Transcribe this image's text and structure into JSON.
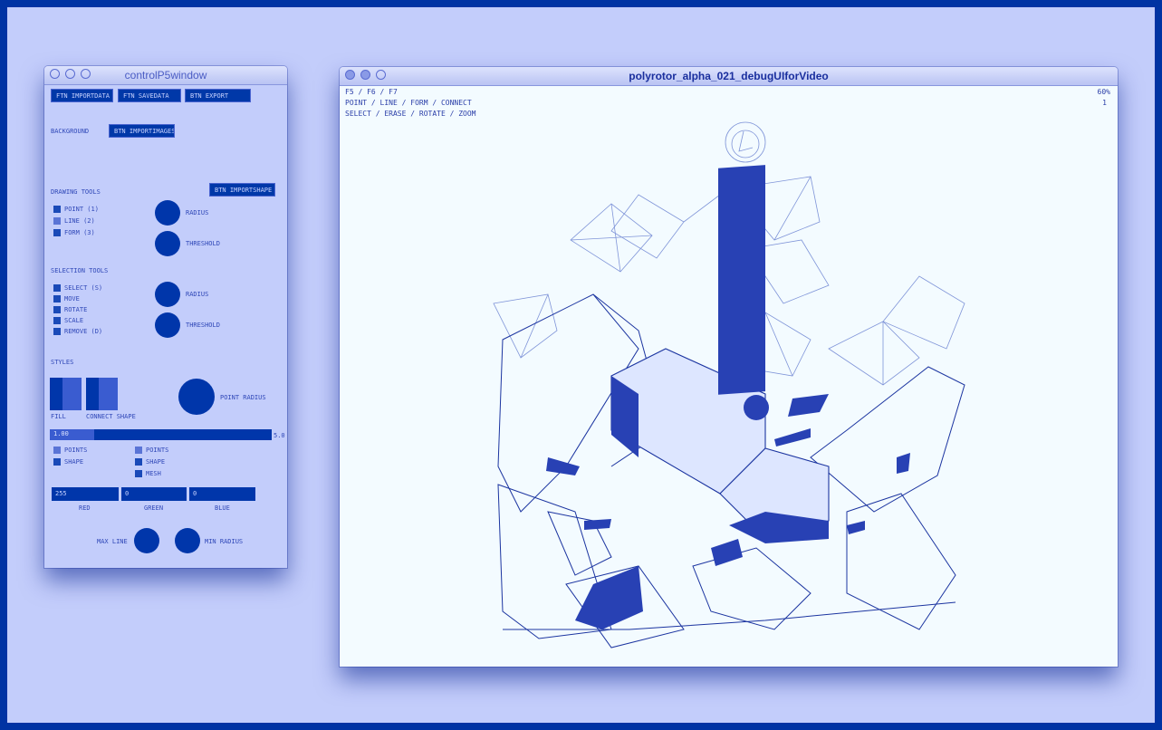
{
  "control_window": {
    "title": "controlP5window",
    "buttons": {
      "import": "FTN IMPORTDATA",
      "savedata": "FTN SAVEDATA",
      "export": "BTN EXPORT",
      "background": "BTN IMPORTIMAGES",
      "import_shape": "BTN IMPORTSHAPE"
    },
    "labels": {
      "background": "BACKGROUND",
      "drawing_tools": "DRAWING TOOLS",
      "selection_tools": "SELECTION TOOLS",
      "styles": "STYLES",
      "fill": "FILL",
      "connect_shape": "CONNECT SHAPE",
      "red": "RED",
      "green": "GREEN",
      "blue": "BLUE"
    },
    "drawing_items": [
      "POINT (1)",
      "LINE (2)",
      "FORM (3)"
    ],
    "selection_items": [
      "SELECT (S)",
      "MOVE",
      "ROTATE",
      "SCALE",
      "REMOVE (D)"
    ],
    "knob_labels": {
      "radius1": "RADIUS",
      "threshold1": "THRESHOLD",
      "radius2": "RADIUS",
      "threshold2": "THRESHOLD",
      "point_radius": "POINT RADIUS",
      "max_line": "MAX LINE",
      "min_radius": "MIN RADIUS"
    },
    "slider": {
      "value": "1.00",
      "max": "5.0",
      "fill": 0.2
    },
    "style_left": [
      "POINTS",
      "SHAPE"
    ],
    "style_right": [
      "POINTS",
      "SHAPE",
      "MESH"
    ],
    "rgb_values": {
      "red": "255",
      "green": "0",
      "blue": "0"
    }
  },
  "render_window": {
    "title": "polyrotor_alpha_021_debugUIforVideo",
    "hud_lines": [
      "F5 / F6 / F7",
      "POINT / LINE / FORM / CONNECT",
      "SELECT / ERASE / ROTATE / ZOOM"
    ],
    "hud_right": [
      "60%",
      "1"
    ]
  },
  "colors": {
    "outer_frame": "#0033a3",
    "desktop": "#c3cdfb",
    "controls": "#0036aa",
    "canvas": "#f3fbff",
    "ink": "#1b34a0"
  }
}
